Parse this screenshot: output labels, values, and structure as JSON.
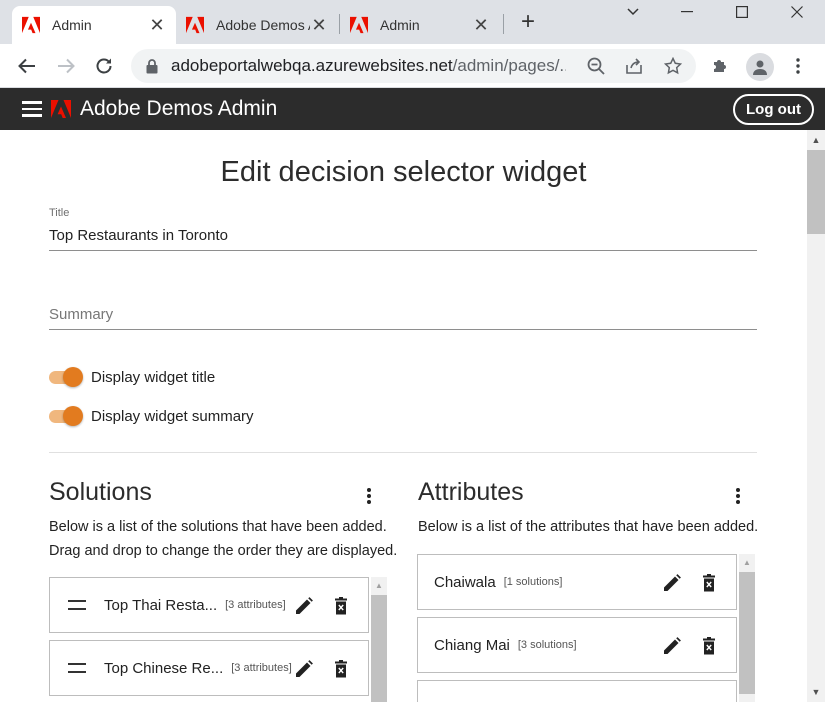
{
  "browser": {
    "tabs": [
      {
        "title": "Admin",
        "active": true
      },
      {
        "title": "Adobe Demos Admin",
        "active": false
      },
      {
        "title": "Admin",
        "active": false
      }
    ],
    "url_host": "adobeportalwebqa.azurewebsites.net",
    "url_path": "/admin/pages/..."
  },
  "app": {
    "title": "Adobe Demos Admin",
    "logout_label": "Log out",
    "brand_color": "#eb1000"
  },
  "form": {
    "heading": "Edit decision selector widget",
    "title_label": "Title",
    "title_value": "Top Restaurants in Toronto",
    "summary_placeholder": "Summary",
    "toggles": [
      {
        "label": "Display widget title",
        "on": true
      },
      {
        "label": "Display widget summary",
        "on": true
      }
    ],
    "accent_color": "#e27b1f"
  },
  "solutions": {
    "title": "Solutions",
    "description_line1": "Below is a list of the solutions that have been added.",
    "description_line2": "Drag and drop to change the order they are displayed.",
    "items": [
      {
        "name": "Top Thai Resta...",
        "count": "[3 attributes]"
      },
      {
        "name": "Top Chinese Re...",
        "count": "[3 attributes]"
      }
    ]
  },
  "attributes": {
    "title": "Attributes",
    "description": "Below is a list of the attributes that have been added.",
    "items": [
      {
        "name": "Chaiwala",
        "count": "[1 solutions]"
      },
      {
        "name": "Chiang Mai",
        "count": "[3 solutions]"
      }
    ]
  }
}
